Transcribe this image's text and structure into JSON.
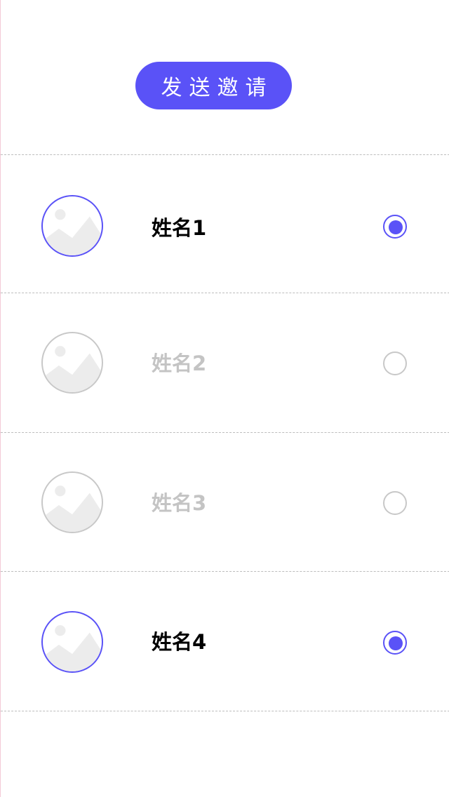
{
  "invite_button": {
    "label": "发送邀请"
  },
  "colors": {
    "accent": "#5a52f7",
    "inactive_border": "#c8c8c8",
    "inactive_text": "#c4c4c4",
    "active_text": "#000000",
    "placeholder_fill": "#ececec"
  },
  "contacts": [
    {
      "name": "姓名1",
      "selected": true
    },
    {
      "name": "姓名2",
      "selected": false
    },
    {
      "name": "姓名3",
      "selected": false
    },
    {
      "name": "姓名4",
      "selected": true
    }
  ]
}
